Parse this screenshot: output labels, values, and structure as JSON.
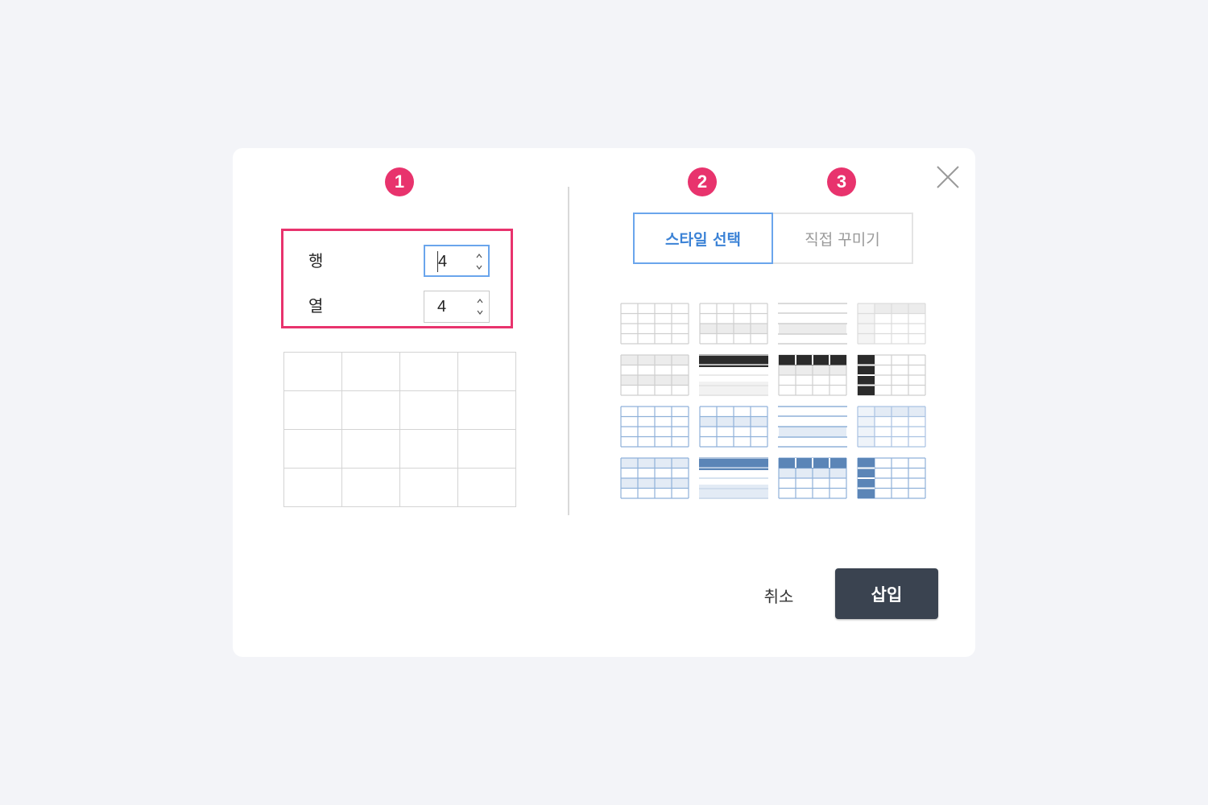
{
  "markers": [
    "1",
    "2",
    "3"
  ],
  "table_size": {
    "rows_label": "행",
    "rows_value": "4",
    "cols_label": "열",
    "cols_value": "4"
  },
  "preview": {
    "rows": 4,
    "cols": 4
  },
  "tabs": {
    "style_select": "스타일 선택",
    "custom_decorate": "직접 꾸미기"
  },
  "style_presets": [
    "plain-gray",
    "gray-alternating-rows",
    "gray-horizontal-lines",
    "gray-light-header",
    "gray-shaded",
    "black-header-bar",
    "black-header-row",
    "black-first-column",
    "blue-plain",
    "blue-alternating-rows",
    "blue-horizontal-lines",
    "blue-light-header",
    "blue-shaded",
    "blue-header-bar",
    "blue-header-row",
    "blue-first-column"
  ],
  "colors": {
    "accent": "#e8336d",
    "tab_active": "#3b82d6",
    "insert_button": "#3a4350",
    "blue_border": "#8fb1d9",
    "blue_fill": "#5b85b7",
    "dark_fill": "#2b2b2b"
  },
  "icons": {
    "close": "close-icon",
    "spin_arrows": "spin-arrows-icon"
  },
  "footer": {
    "cancel": "취소",
    "insert": "삽입"
  }
}
